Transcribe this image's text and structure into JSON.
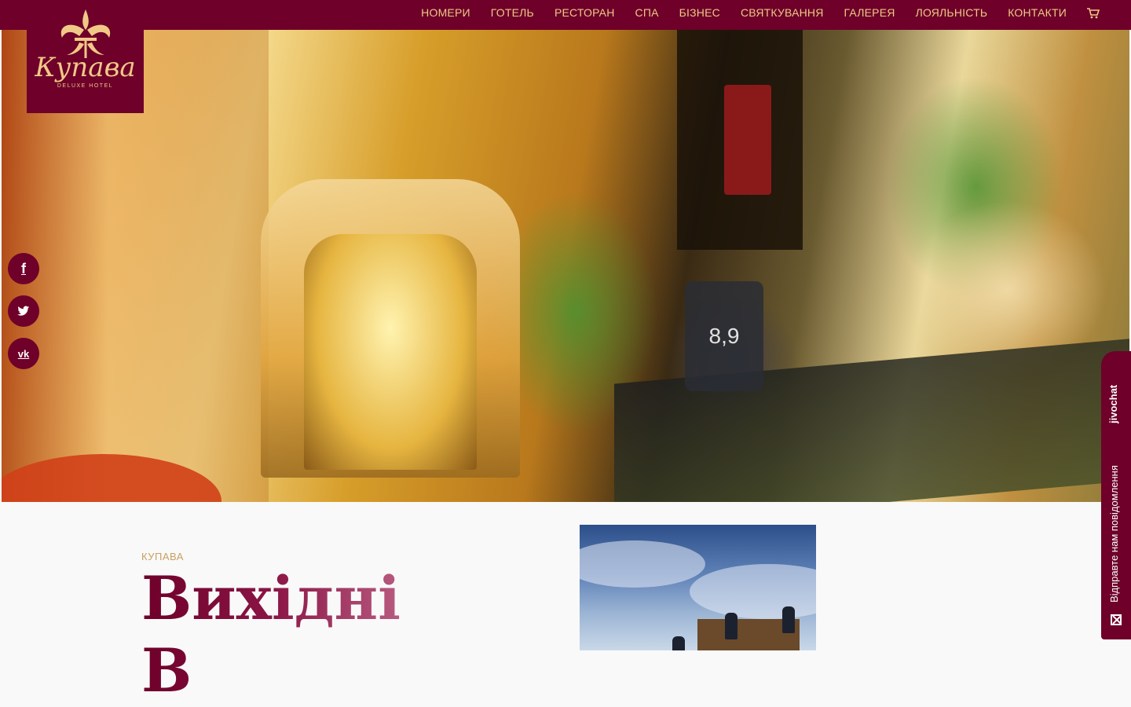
{
  "header": {
    "logo": {
      "name": "Купава",
      "sub": "DELUXE HOTEL"
    },
    "nav": [
      {
        "label": "НОМЕРИ"
      },
      {
        "label": "ГОТЕЛЬ"
      },
      {
        "label": "РЕСТОРАН"
      },
      {
        "label": "СПА"
      },
      {
        "label": "БІЗНЕС"
      },
      {
        "label": "СВЯТКУВАННЯ"
      },
      {
        "label": "ГАЛЕРЕЯ"
      },
      {
        "label": "ЛОЯЛЬНІСТЬ"
      },
      {
        "label": "КОНТАКТИ"
      }
    ],
    "cart_icon": "cart-icon"
  },
  "hero": {
    "price_text": "8,9"
  },
  "social": [
    {
      "icon": "facebook-icon",
      "glyph": "f"
    },
    {
      "icon": "twitter-icon",
      "glyph": ""
    },
    {
      "icon": "vk-icon",
      "glyph": "vk"
    }
  ],
  "content": {
    "kicker": "КУПАВА",
    "title": "Вихідні\nВ"
  },
  "chat": {
    "brand": "jivochat",
    "message": "Відправте нам повідомлення"
  },
  "colors": {
    "brand": "#6e0029",
    "gold": "#f0c987",
    "kicker": "#c9a060"
  }
}
